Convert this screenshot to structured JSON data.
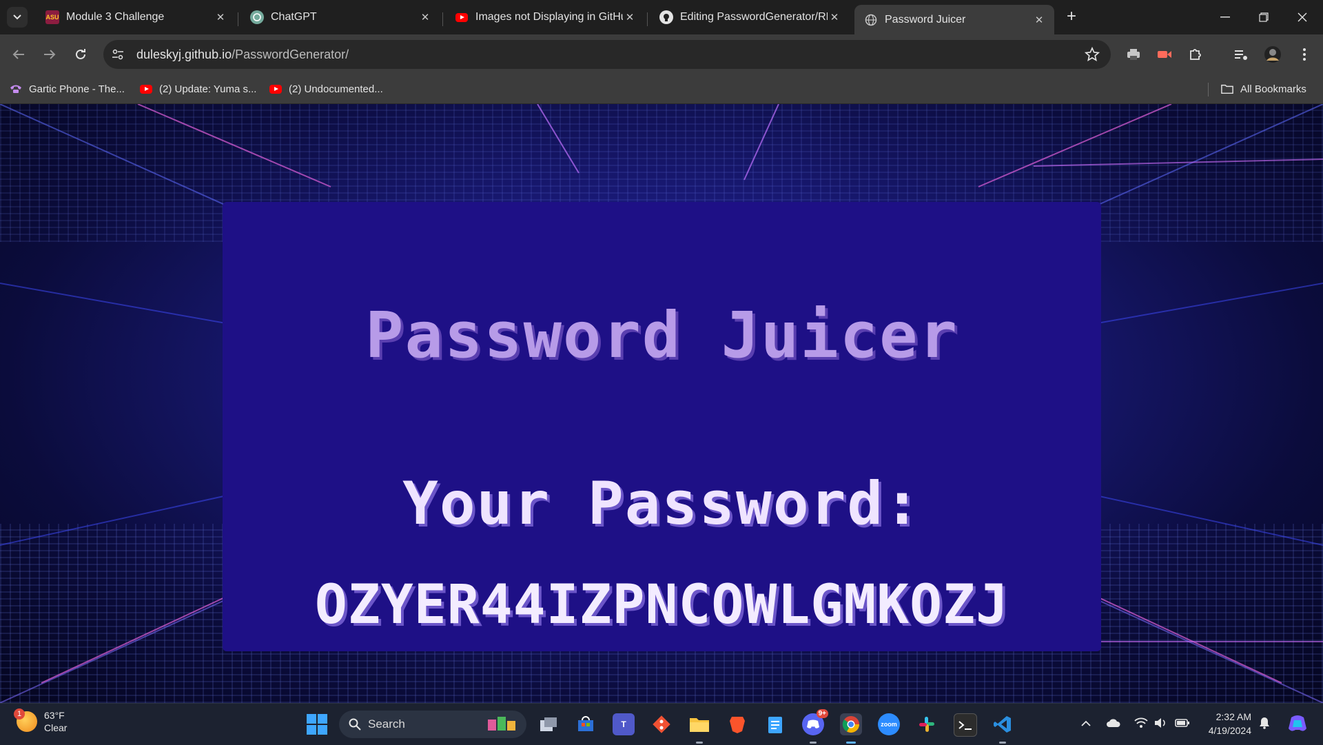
{
  "browser": {
    "tabs": [
      {
        "title": "Module 3 Challenge",
        "favicon": "asu-icon",
        "active": false
      },
      {
        "title": "ChatGPT",
        "favicon": "chatgpt-icon",
        "active": false
      },
      {
        "title": "Images not Displaying in GitHu",
        "favicon": "youtube-icon",
        "active": false
      },
      {
        "title": "Editing PasswordGenerator/RE",
        "favicon": "github-icon",
        "active": false
      },
      {
        "title": "Password Juicer",
        "favicon": "globe-icon",
        "active": true
      }
    ],
    "address": {
      "domain": "duleskyj.github.io",
      "path": "/PasswordGenerator/"
    },
    "bookmarks": [
      {
        "label": "Gartic Phone - The...",
        "icon": "phone-icon"
      },
      {
        "label": "(2) Update: Yuma s...",
        "icon": "youtube-icon"
      },
      {
        "label": "(2) Undocumented...",
        "icon": "youtube-icon"
      }
    ],
    "all_bookmarks_label": "All Bookmarks"
  },
  "page": {
    "title": "Password Juicer",
    "password_label": "Your Password:",
    "password_value": "OZYER44IZPNCOWLGMKOZJ"
  },
  "taskbar": {
    "weather": {
      "temp": "63°F",
      "condition": "Clear",
      "badge": "1"
    },
    "search_label": "Search",
    "discord_badge": "9+",
    "clock": {
      "time": "2:32 AM",
      "date": "4/19/2024"
    }
  },
  "colors": {
    "panel": "#1e1086",
    "title": "#b79be8",
    "password_text": "#f3ecff",
    "chrome_dark": "#1f1f1f",
    "chrome_toolbar": "#3c3c3c"
  }
}
